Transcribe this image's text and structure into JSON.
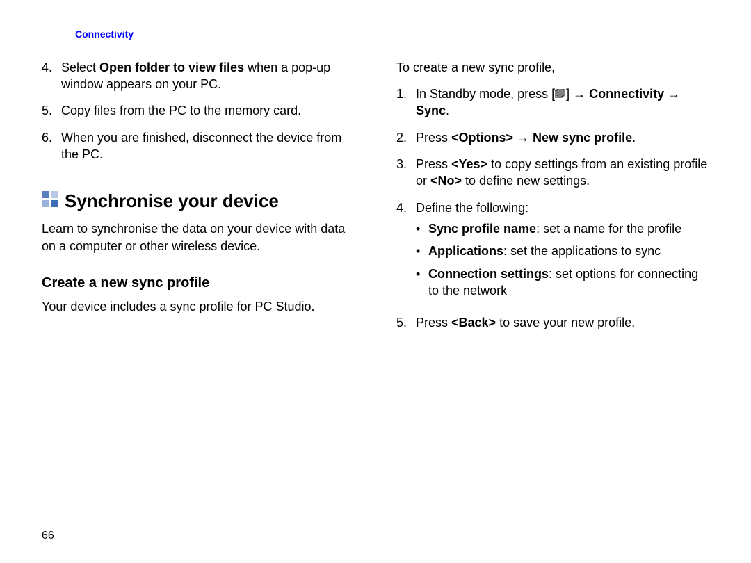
{
  "header": {
    "section_label": "Connectivity"
  },
  "page_number": "66",
  "left": {
    "steps": [
      {
        "n": "4.",
        "pre": "Select ",
        "bold": "Open folder to view files",
        "post": " when a pop-up window appears on your PC."
      },
      {
        "n": "5.",
        "text": "Copy files from the PC to the memory card."
      },
      {
        "n": "6.",
        "text": "When you are finished, disconnect the device from the PC."
      }
    ],
    "heading": "Synchronise your device",
    "intro": "Learn to synchronise the data on your device with data on a computer or other wireless device.",
    "subheading": "Create a new sync profile",
    "subintro": "Your device includes a sync profile for PC Studio."
  },
  "right": {
    "lead": "To create a new sync profile,",
    "steps": {
      "s1": {
        "n": "1.",
        "pre": "In Standby mode, press [",
        "post": "] → ",
        "bold": "Connectivity → Sync",
        "tail": "."
      },
      "s2": {
        "n": "2.",
        "pre": "Press ",
        "b1": "<Options>",
        "mid": " → ",
        "b2": "New sync profile",
        "tail": "."
      },
      "s3": {
        "n": "3.",
        "a": "Press ",
        "b1": "<Yes>",
        "b": " to copy settings from an existing profile or ",
        "b2": "<No>",
        "c": " to define new settings."
      },
      "s4": {
        "n": "4.",
        "text": "Define the following:"
      },
      "s5": {
        "n": "5.",
        "a": "Press ",
        "b1": "<Back>",
        "b": " to save your new profile."
      }
    },
    "bullets": {
      "b1": {
        "label": "Sync profile name",
        "text": ": set a name for the profile"
      },
      "b2": {
        "label": "Applications",
        "text": ": set the applications to sync"
      },
      "b3": {
        "label": "Connection settings",
        "text": ": set options for connecting to the network"
      }
    }
  }
}
